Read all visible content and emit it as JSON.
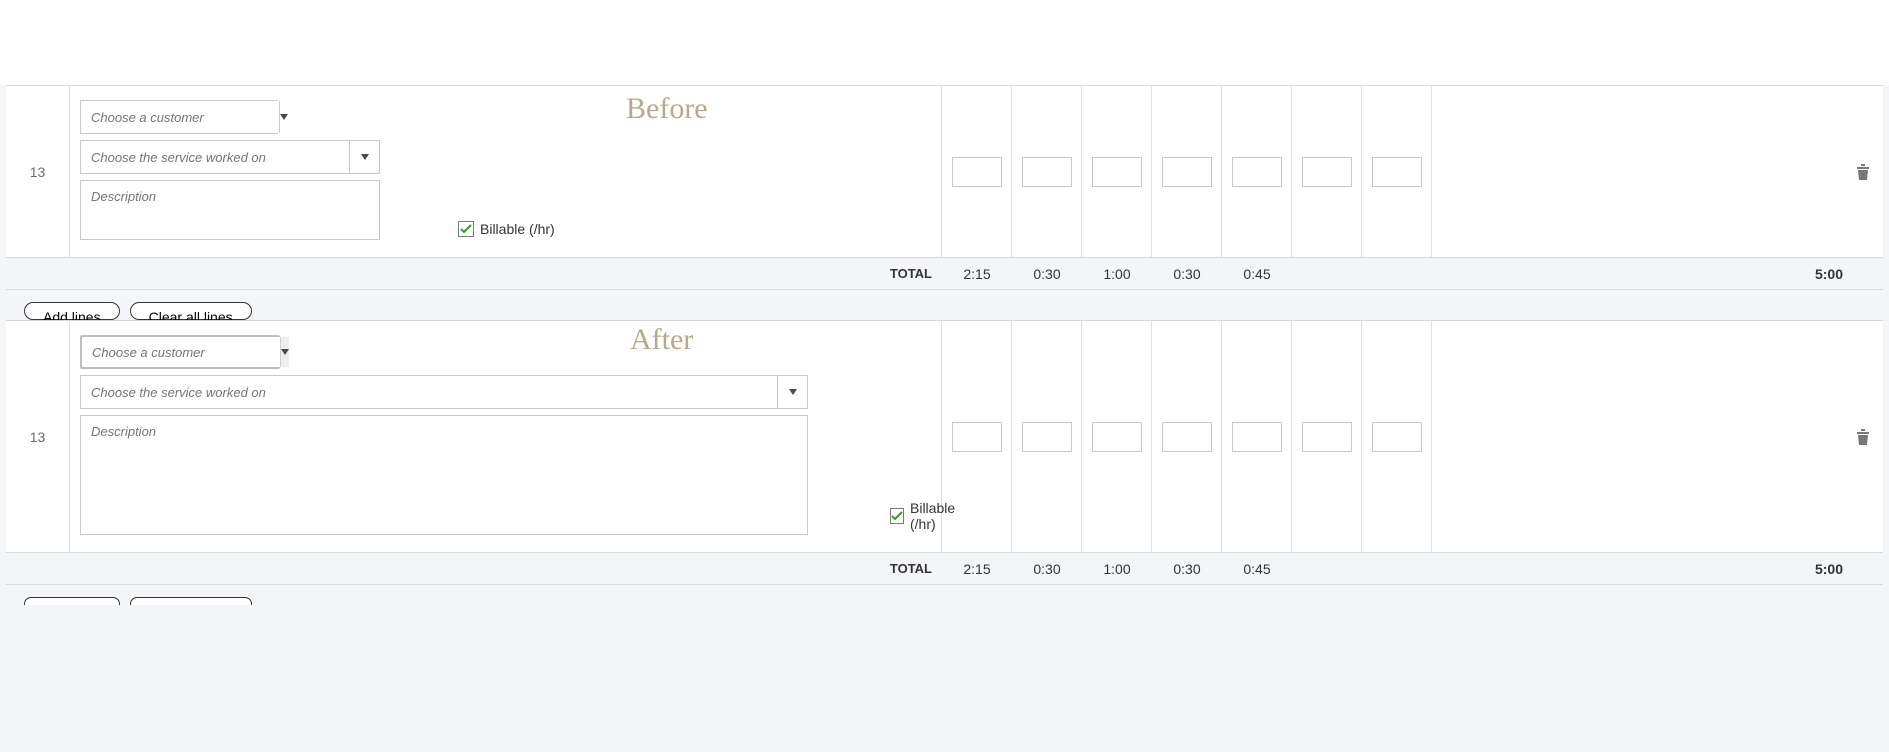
{
  "labels": {
    "before": "Before",
    "after": "After"
  },
  "placeholders": {
    "customer": "Choose a customer",
    "service": "Choose the service worked on",
    "description": "Description"
  },
  "row_number": "13",
  "billable_label": "Billable (/hr)",
  "billable_checked": true,
  "totals": {
    "label": "TOTAL",
    "cells": [
      "2:15",
      "0:30",
      "1:00",
      "0:30",
      "0:45",
      "",
      ""
    ],
    "grand": "5:00"
  },
  "buttons": {
    "add_lines": "Add lines",
    "clear_all": "Clear all lines"
  },
  "time_inputs": [
    "",
    "",
    "",
    "",
    "",
    "",
    ""
  ]
}
